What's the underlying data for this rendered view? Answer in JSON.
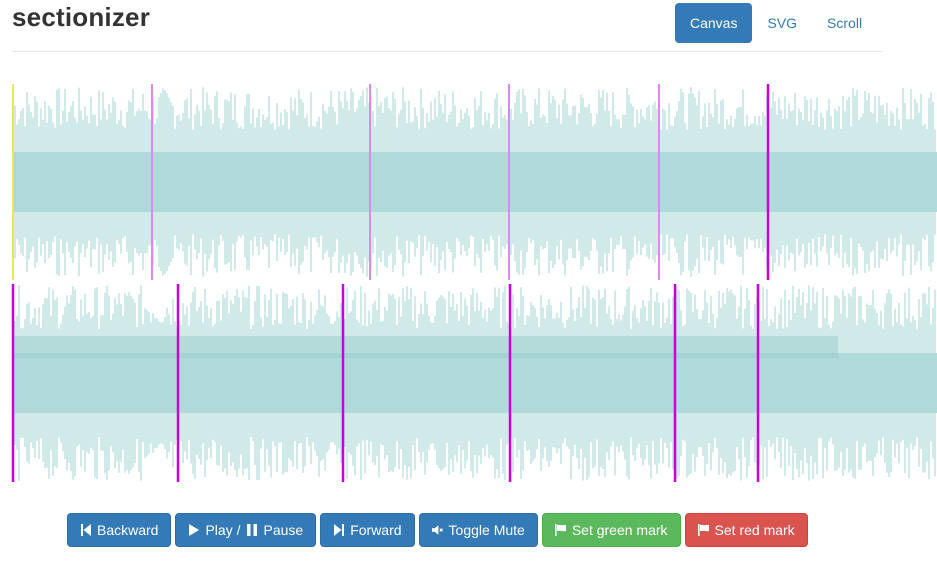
{
  "header": {
    "title": "sectionizer",
    "tabs": [
      {
        "label": "Canvas",
        "active": true
      },
      {
        "label": "SVG",
        "active": false
      },
      {
        "label": "Scroll",
        "active": false
      }
    ]
  },
  "waveform": {
    "wave_color": "#b0dada",
    "progress_color": "#9ac9c9",
    "cursor_color": "#e8e84a",
    "section_colors": {
      "violet": "#dd88ee",
      "magenta": "#cc00dd"
    }
  },
  "controls": {
    "backward": {
      "label": "Backward",
      "icon": "step-backward-icon"
    },
    "play": {
      "label": "Play /",
      "icon": "play-icon"
    },
    "pause": {
      "label": "Pause",
      "icon": "pause-icon"
    },
    "forward": {
      "label": "Forward",
      "icon": "step-forward-icon"
    },
    "mute": {
      "label": "Toggle Mute",
      "icon": "volume-off-icon"
    },
    "green_mark": {
      "label": "Set green mark",
      "icon": "flag-icon"
    },
    "red_mark": {
      "label": "Set red mark",
      "icon": "flag-icon"
    }
  }
}
